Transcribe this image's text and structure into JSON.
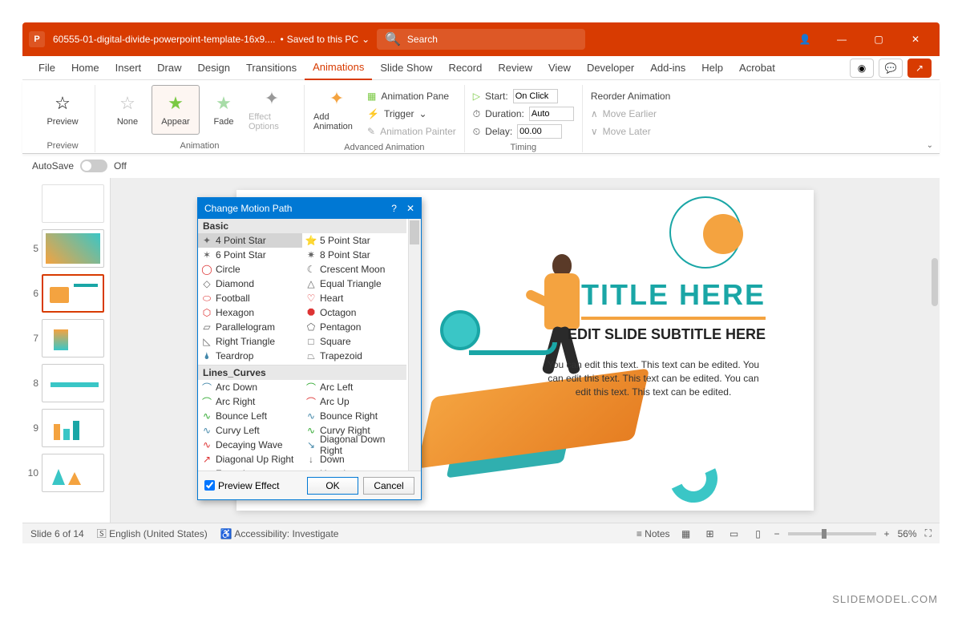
{
  "titlebar": {
    "app_icon": "P",
    "doc_title": "60555-01-digital-divide-powerpoint-template-16x9....",
    "saved_status": "Saved to this PC",
    "search_placeholder": "Search"
  },
  "ribbon_tabs": [
    "File",
    "Home",
    "Insert",
    "Draw",
    "Design",
    "Transitions",
    "Animations",
    "Slide Show",
    "Record",
    "Review",
    "View",
    "Developer",
    "Add-ins",
    "Help",
    "Acrobat"
  ],
  "active_tab": "Animations",
  "ribbon": {
    "preview": {
      "label": "Preview",
      "group": "Preview"
    },
    "gallery": [
      {
        "label": "None",
        "icon": "star-outline",
        "color": "#bbb"
      },
      {
        "label": "Appear",
        "icon": "star",
        "color": "#7ac943",
        "selected": true
      },
      {
        "label": "Fade",
        "icon": "star",
        "color": "#a7dca7"
      }
    ],
    "effect_options": "Effect Options",
    "add_animation": "Add Animation",
    "advanced": {
      "group": "Advanced Animation",
      "pane": "Animation Pane",
      "trigger": "Trigger",
      "painter": "Animation Painter"
    },
    "timing": {
      "group": "Timing",
      "start_label": "Start:",
      "start_value": "On Click",
      "duration_label": "Duration:",
      "duration_value": "Auto",
      "delay_label": "Delay:",
      "delay_value": "00.00",
      "reorder": "Reorder Animation",
      "earlier": "Move Earlier",
      "later": "Move Later"
    }
  },
  "autosave": {
    "label": "AutoSave",
    "state": "Off"
  },
  "thumbs": [
    {
      "num": "5"
    },
    {
      "num": "6",
      "active": true,
      "starred": true
    },
    {
      "num": "7"
    },
    {
      "num": "8"
    },
    {
      "num": "9"
    },
    {
      "num": "10"
    }
  ],
  "slide": {
    "title": "TITLE HERE",
    "subtitle": "EDIT SLIDE SUBTITLE HERE",
    "body": "You can edit this text. This text can be edited. You can edit this text. This text can be edited. You can edit this text. This text can be edited."
  },
  "dialog": {
    "title": "Change Motion Path",
    "sections": [
      {
        "header": "Basic",
        "selected": "4 Point Star",
        "items": [
          "4 Point Star",
          "5 Point Star",
          "6 Point Star",
          "8 Point Star",
          "Circle",
          "Crescent Moon",
          "Diamond",
          "Equal Triangle",
          "Football",
          "Heart",
          "Hexagon",
          "Octagon",
          "Parallelogram",
          "Pentagon",
          "Right Triangle",
          "Square",
          "Teardrop",
          "Trapezoid"
        ]
      },
      {
        "header": "Lines_Curves",
        "items": [
          "Arc Down",
          "Arc Left",
          "Arc Right",
          "Arc Up",
          "Bounce Left",
          "Bounce Right",
          "Curvy Left",
          "Curvy Right",
          "Decaying Wave",
          "Diagonal Down Right",
          "Diagonal Up Right",
          "Down",
          "Funnel",
          "Heartbeat"
        ]
      }
    ],
    "preview_effect": "Preview Effect",
    "ok": "OK",
    "cancel": "Cancel"
  },
  "status": {
    "slide": "Slide 6 of 14",
    "lang": "English (United States)",
    "access": "Accessibility: Investigate",
    "notes": "Notes",
    "zoom": "56%"
  },
  "watermark": "SLIDEMODEL.COM"
}
